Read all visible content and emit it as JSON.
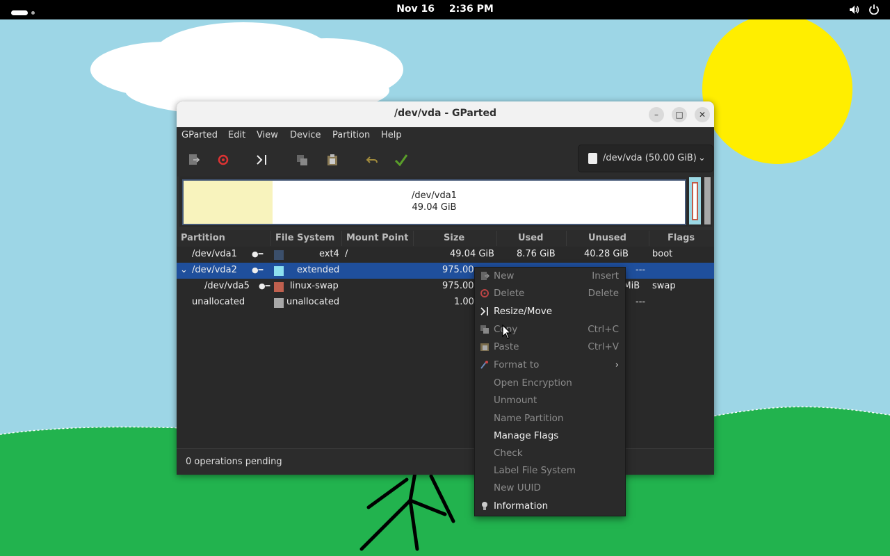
{
  "topbar": {
    "date": "Nov 16",
    "time": "2:36 PM"
  },
  "window": {
    "title": "/dev/vda - GParted",
    "minimize": "–",
    "maximize": "□",
    "close": "✕"
  },
  "menubar": [
    "GParted",
    "Edit",
    "View",
    "Device",
    "Partition",
    "Help"
  ],
  "toolbar": {
    "icons": [
      "new-icon",
      "delete-icon",
      "resize-move-icon",
      "copy-icon",
      "paste-icon",
      "undo-icon",
      "apply-icon"
    ],
    "device_select": "/dev/vda (50.00 GiB)"
  },
  "disk_map": {
    "vda1_name": "/dev/vda1",
    "vda1_size": "49.04 GiB",
    "vda1_used_fraction": 0.178
  },
  "table": {
    "headers": [
      "Partition",
      "File System",
      "Mount Point",
      "Size",
      "Used",
      "Unused",
      "Flags"
    ],
    "rows": [
      {
        "partition": "/dev/vda1",
        "filesystem": "ext4",
        "mount": "/",
        "size": "49.04 GiB",
        "used": "8.76 GiB",
        "unused": "40.28 GiB",
        "flags": "boot",
        "color": "#3b4f6b"
      },
      {
        "partition": "/dev/vda2",
        "filesystem": "extended",
        "mount": "",
        "size": "975.00",
        "used": "",
        "unused": "---",
        "flags": "",
        "color": "#8ce0f0"
      },
      {
        "partition": "/dev/vda5",
        "filesystem": "linux-swap",
        "mount": "",
        "size": "975.00",
        "used": "",
        "unused": "0 MiB",
        "flags": "swap",
        "color": "#c0604e"
      },
      {
        "partition": "unallocated",
        "filesystem": "unallocated",
        "mount": "",
        "size": "1.00",
        "used": "",
        "unused": "---",
        "flags": "",
        "color": "#a8a8a8"
      }
    ]
  },
  "status": "0 operations pending",
  "context_menu": [
    {
      "label": "New",
      "accel": "Insert",
      "enabled": false,
      "icon": "new-icon"
    },
    {
      "label": "Delete",
      "accel": "Delete",
      "enabled": false,
      "icon": "delete-icon"
    },
    {
      "label": "Resize/Move",
      "accel": "",
      "enabled": true,
      "icon": "resize-move-icon"
    },
    {
      "label": "Copy",
      "accel": "Ctrl+C",
      "enabled": false,
      "icon": "copy-icon"
    },
    {
      "label": "Paste",
      "accel": "Ctrl+V",
      "enabled": false,
      "icon": "paste-icon"
    },
    {
      "label": "Format to",
      "accel": "›",
      "enabled": false,
      "icon": "format-icon"
    },
    {
      "label": "Open Encryption",
      "accel": "",
      "enabled": false,
      "icon": ""
    },
    {
      "label": "Unmount",
      "accel": "",
      "enabled": false,
      "icon": ""
    },
    {
      "label": "Name Partition",
      "accel": "",
      "enabled": false,
      "icon": ""
    },
    {
      "label": "Manage Flags",
      "accel": "",
      "enabled": true,
      "icon": ""
    },
    {
      "label": "Check",
      "accel": "",
      "enabled": false,
      "icon": ""
    },
    {
      "label": "Label File System",
      "accel": "",
      "enabled": false,
      "icon": ""
    },
    {
      "label": "New UUID",
      "accel": "",
      "enabled": false,
      "icon": ""
    },
    {
      "label": "Information",
      "accel": "",
      "enabled": true,
      "icon": "information-icon"
    }
  ]
}
